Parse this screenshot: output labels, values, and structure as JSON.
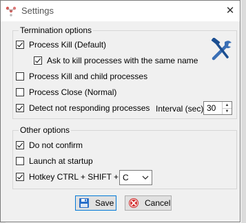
{
  "window": {
    "title": "Settings",
    "close_glyph": "✕"
  },
  "termination": {
    "legend": "Termination options",
    "process_kill": {
      "label": "Process Kill (Default)",
      "checked": true
    },
    "ask_kill_same_name": {
      "label": "Ask to kill processes with the same name",
      "checked": true
    },
    "kill_children": {
      "label": "Process Kill and child processes",
      "checked": false
    },
    "process_close": {
      "label": "Process Close (Normal)",
      "checked": false
    },
    "detect_not_responding": {
      "label": "Detect not responding processes",
      "checked": true
    },
    "interval_label": "Interval (sec)",
    "interval_value": "30"
  },
  "other": {
    "legend": "Other options",
    "do_not_confirm": {
      "label": "Do not confirm",
      "checked": true
    },
    "launch_at_startup": {
      "label": "Launch at startup",
      "checked": false
    },
    "hotkey": {
      "label": "Hotkey CTRL + SHIFT +",
      "checked": true,
      "key_value": "C"
    }
  },
  "buttons": {
    "save": "Save",
    "cancel": "Cancel"
  },
  "icons": {
    "app": "settings-app-icon",
    "tools": "hammer-wrench-icon",
    "save": "floppy-disk-icon",
    "cancel": "cancel-icon"
  },
  "colors": {
    "accent": "#0078d7",
    "cancel_red": "#d32f2f",
    "save_blue": "#2a6fc9"
  }
}
